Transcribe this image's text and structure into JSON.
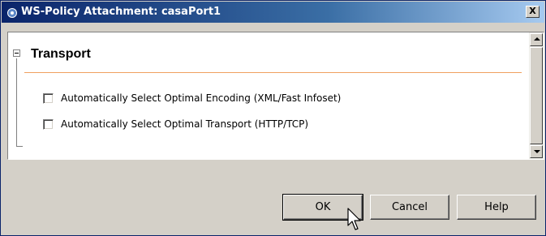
{
  "window": {
    "title": "WS-Policy Attachment: casaPort1",
    "icon": "app-gear-icon",
    "close_label": "X"
  },
  "panel": {
    "section_title": "Transport",
    "options": [
      {
        "label": "Automatically Select Optimal Encoding (XML/Fast Infoset)",
        "checked": false
      },
      {
        "label": "Automatically Select Optimal Transport (HTTP/TCP)",
        "checked": false
      }
    ]
  },
  "buttons": {
    "ok": "OK",
    "cancel": "Cancel",
    "help": "Help"
  },
  "colors": {
    "title_gradient_start": "#0a246a",
    "title_gradient_end": "#a6caf0",
    "section_rule": "#f0a060",
    "dialog_bg": "#d4d0c8"
  }
}
